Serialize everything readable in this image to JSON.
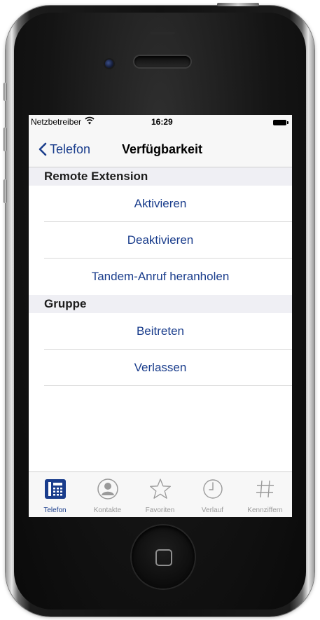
{
  "colors": {
    "accent": "#1a3d8c",
    "tab_inactive": "#9a9a9a",
    "section_bg": "#efeff4",
    "bar_bg": "#f7f7f7"
  },
  "status_bar": {
    "carrier": "Netzbetreiber",
    "time": "16:29",
    "wifi_icon": "wifi-icon",
    "battery_icon": "battery-icon"
  },
  "nav": {
    "back_label": "Telefon",
    "back_icon": "chevron-left-icon",
    "title": "Verfügbarkeit"
  },
  "sections": [
    {
      "header": "Remote Extension",
      "items": [
        "Aktivieren",
        "Deaktivieren",
        "Tandem-Anruf heranholen"
      ]
    },
    {
      "header": "Gruppe",
      "items": [
        "Beitreten",
        "Verlassen"
      ]
    }
  ],
  "tab_bar": {
    "active": "Telefon",
    "tabs": [
      {
        "label": "Telefon",
        "icon": "phone-keypad-icon"
      },
      {
        "label": "Kontakte",
        "icon": "contact-icon"
      },
      {
        "label": "Favoriten",
        "icon": "star-icon"
      },
      {
        "label": "Verlauf",
        "icon": "clock-icon"
      },
      {
        "label": "Kennziffern",
        "icon": "hash-icon"
      }
    ]
  }
}
